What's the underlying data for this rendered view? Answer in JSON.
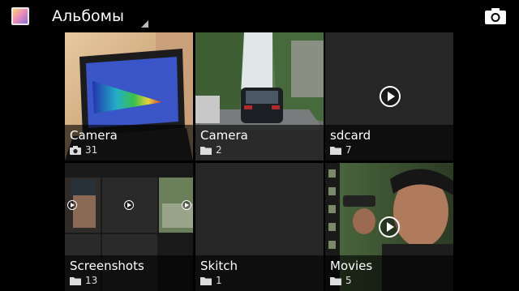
{
  "action_bar": {
    "title": "Альбомы",
    "app_icon": "gallery-icon",
    "camera_icon": "camera-icon"
  },
  "albums": [
    {
      "name": "Camera",
      "count": "31",
      "icon": "camera-icon"
    },
    {
      "name": "Camera",
      "count": "2",
      "icon": "folder-icon"
    },
    {
      "name": "sdcard",
      "count": "7",
      "icon": "folder-icon"
    },
    {
      "name": "Screenshots",
      "count": "13",
      "icon": "folder-icon"
    },
    {
      "name": "Skitch",
      "count": "1",
      "icon": "folder-icon"
    },
    {
      "name": "Movies",
      "count": "5",
      "icon": "folder-icon"
    }
  ],
  "colors": {
    "background": "#000000",
    "tile": "#2b2b2b",
    "label_overlay": "rgba(0,0,0,0.62)"
  }
}
